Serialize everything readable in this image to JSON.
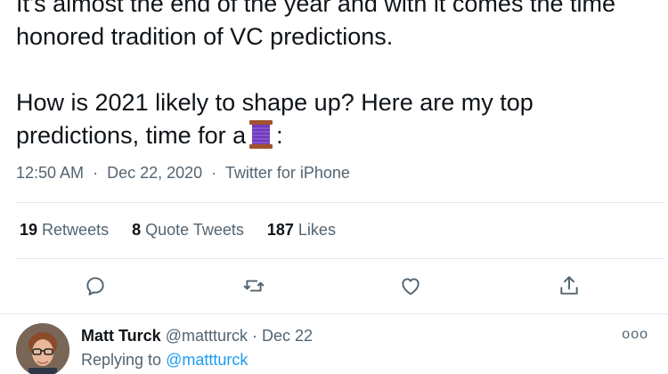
{
  "tweet": {
    "line_0": "It's almost the end of the year and with it comes the time",
    "line_1": "honored tradition of VC predictions.",
    "line_2": "How is 2021 likely to shape up? Here are my top",
    "line_3_before": "predictions, time for a",
    "line_3_after": ":",
    "emoji_icon": "thread-spool-icon"
  },
  "meta": {
    "time": "12:50 AM",
    "date": "Dec 22, 2020",
    "separator": "·",
    "source": "Twitter for iPhone"
  },
  "stats": {
    "retweets_count": "19",
    "retweets_label": "Retweets",
    "quotes_count": "8",
    "quotes_label": "Quote Tweets",
    "likes_count": "187",
    "likes_label": "Likes"
  },
  "actions": [
    "reply-icon",
    "retweet-icon",
    "like-icon",
    "share-icon"
  ],
  "reply": {
    "name": "Matt Turck",
    "handle": "@mattturck",
    "dot": "·",
    "date": "Dec 22",
    "replying_prefix": "Replying to",
    "replying_handle": "@mattturck",
    "more_label": "ooo"
  },
  "colors": {
    "text": "#0f1419",
    "secondary": "#536471",
    "link": "#1d9bf0",
    "divider": "#e1e8ed"
  }
}
